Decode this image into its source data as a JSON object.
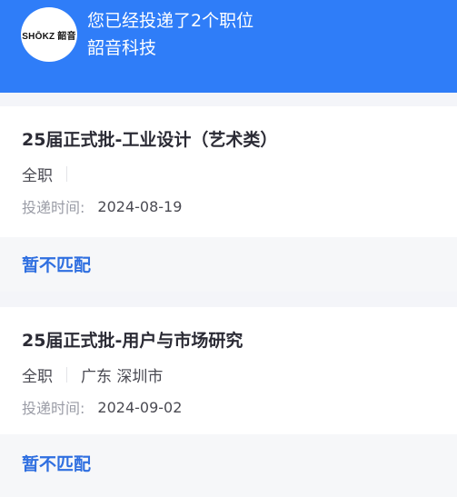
{
  "header": {
    "logo_text": "SHŌKZ 韶音",
    "applied_text": "您已经投递了2个职位",
    "company_name": "韶音科技",
    "background_color": "#2f7df8"
  },
  "applications": [
    {
      "title": "25届正式批-工业设计（艺术类）",
      "job_type": "全职",
      "location": "",
      "time_label": "投递时间:",
      "time_value": "2024-08-19",
      "status": "暂不匹配"
    },
    {
      "title": "25届正式批-用户与市场研究",
      "job_type": "全职",
      "location": "广东 深圳市",
      "time_label": "投递时间:",
      "time_value": "2024-09-02",
      "status": "暂不匹配"
    }
  ],
  "colors": {
    "status_accent": "#2f6fe0",
    "page_background": "#f4f5f9"
  }
}
